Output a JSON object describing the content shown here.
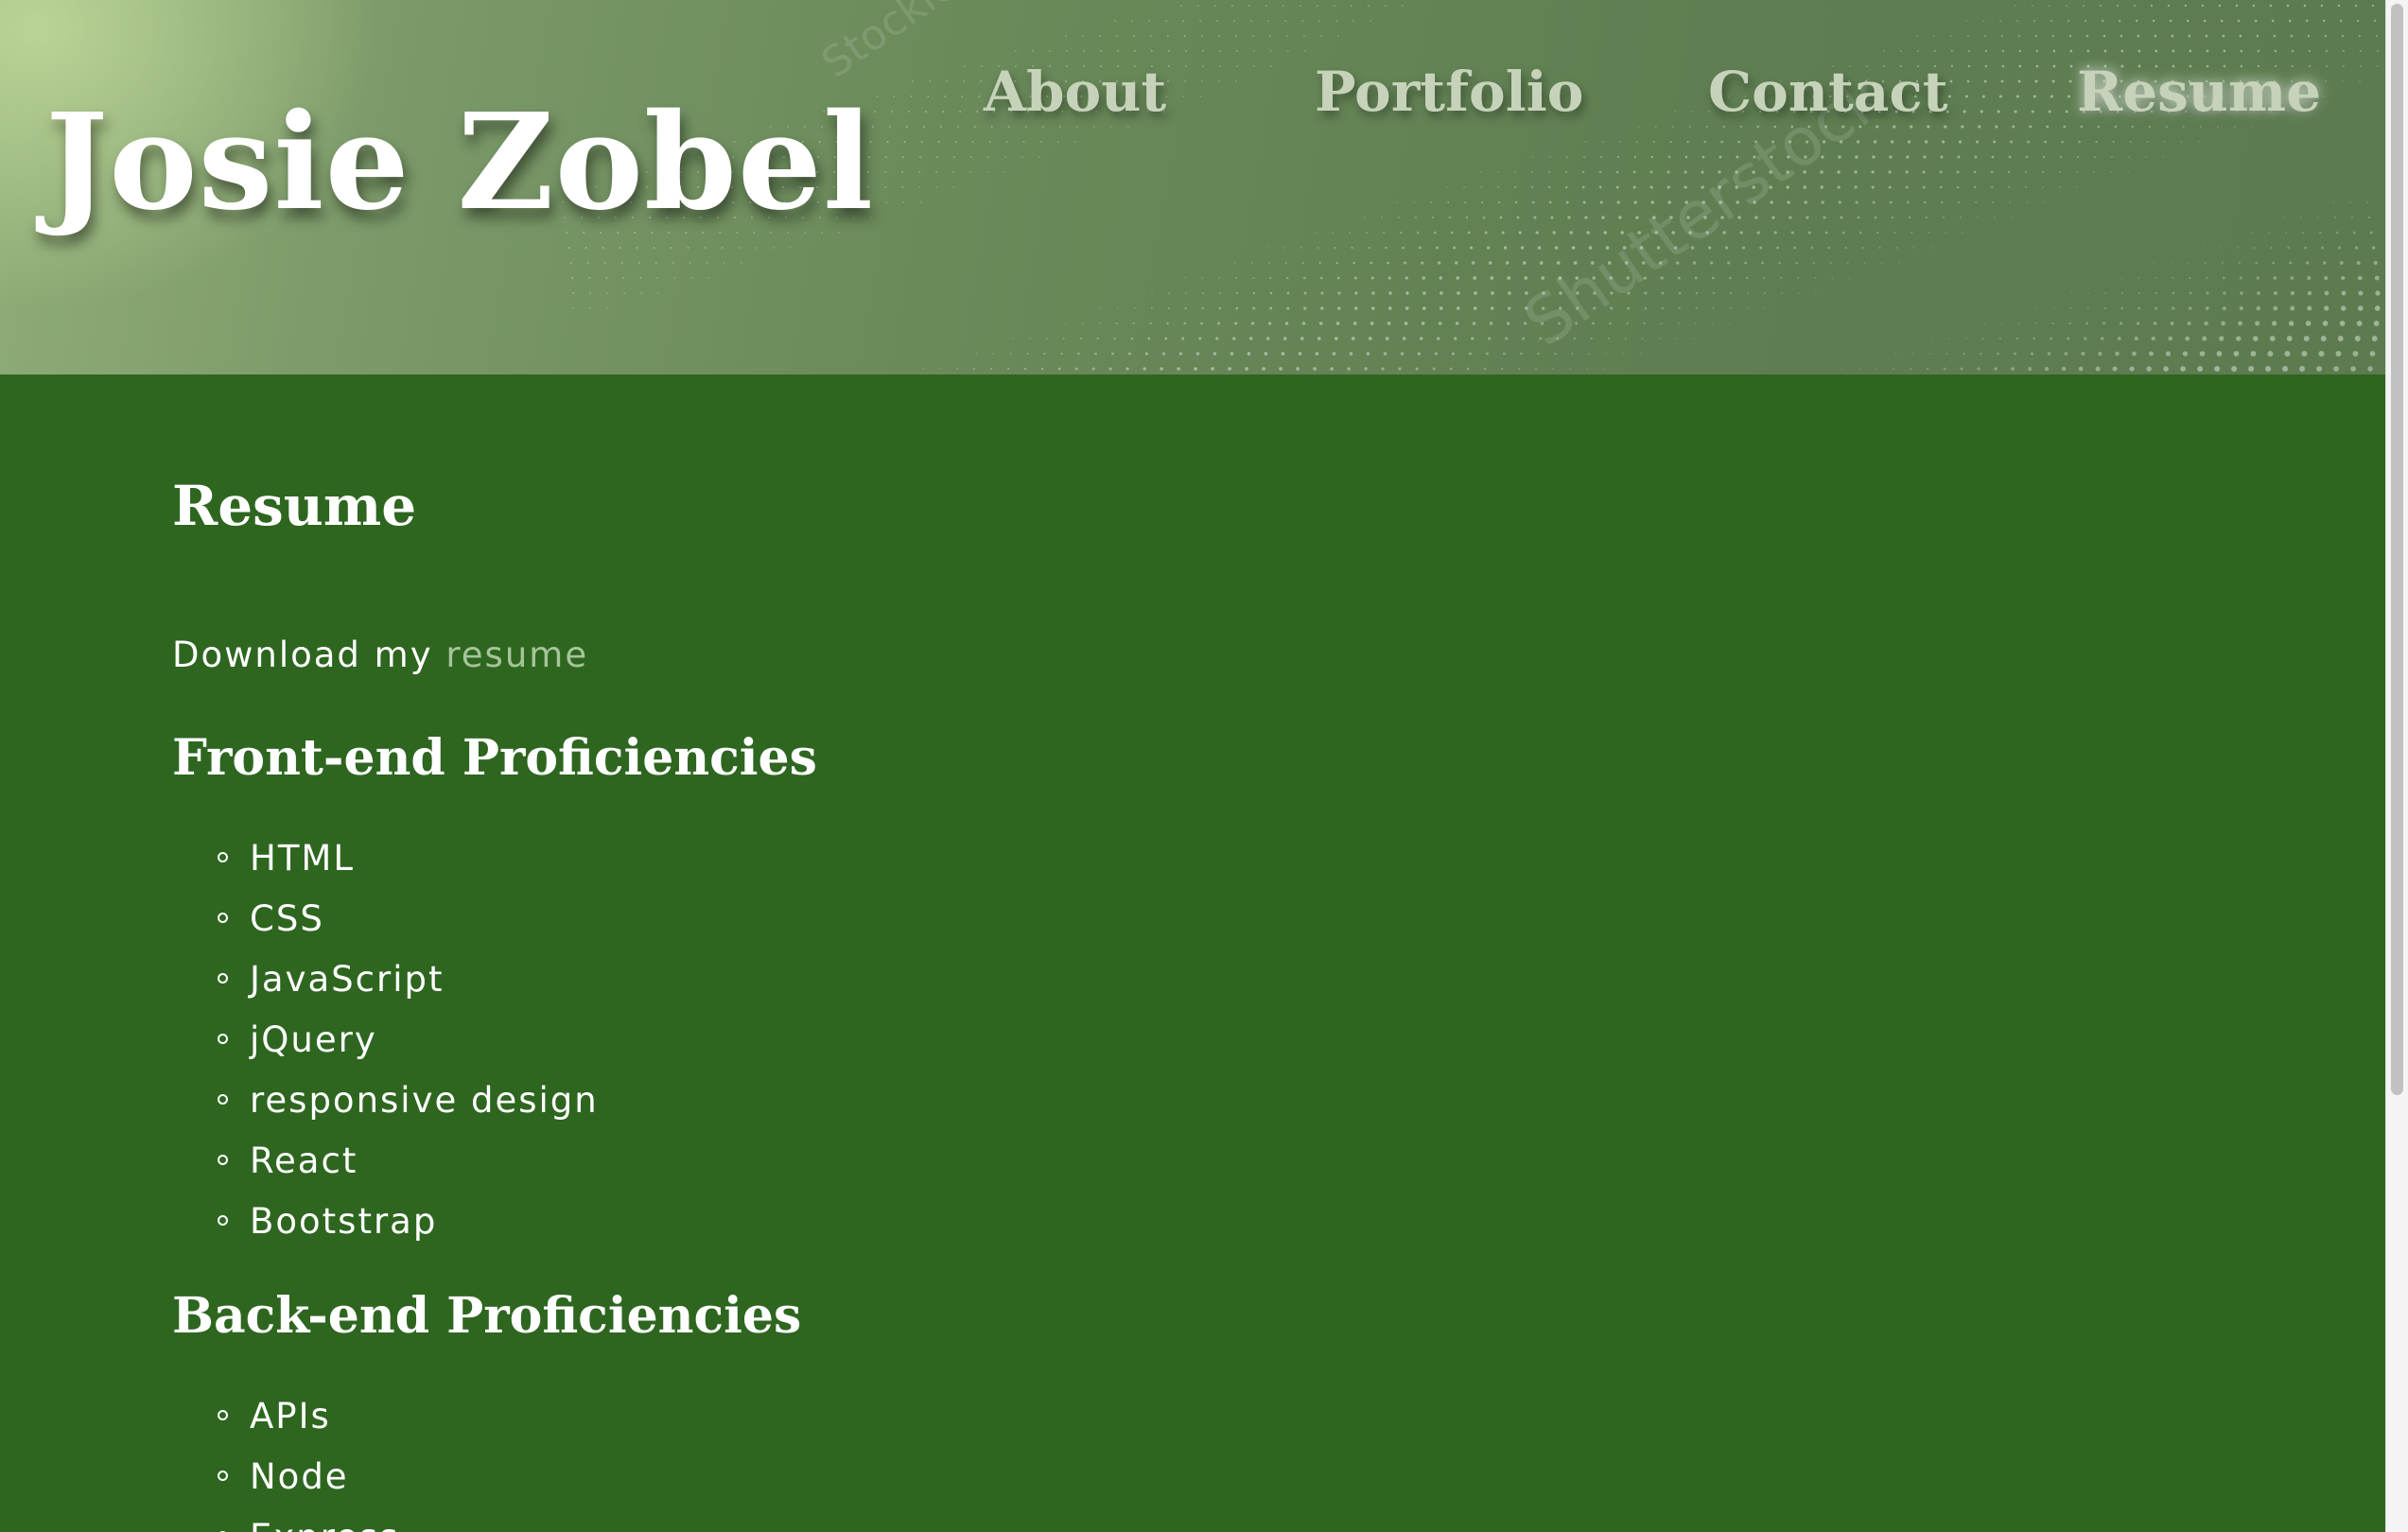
{
  "header": {
    "brand": "Josie Zobel",
    "nav": [
      {
        "label": "About"
      },
      {
        "label": "Portfolio"
      },
      {
        "label": "Contact"
      },
      {
        "label": "Resume",
        "active": true
      }
    ],
    "watermark_text": [
      "Stockle",
      "Shutterstock"
    ]
  },
  "main": {
    "title": "Resume",
    "download_prefix": "Download my",
    "download_link": "resume",
    "frontend": {
      "heading": "Front-end Proficiencies",
      "items": [
        "HTML",
        "CSS",
        "JavaScript",
        "jQuery",
        "responsive design",
        "React",
        "Bootstrap"
      ]
    },
    "backend": {
      "heading": "Back-end Proficiencies",
      "items": [
        "APIs",
        "Node",
        "Express"
      ]
    }
  },
  "colors": {
    "page_background": "#2e6620",
    "header_tint": "#5f7f52",
    "nav_text": "#c6d3ba",
    "link": "#a8c49a",
    "text": "#ffffff"
  },
  "icons": {
    "bullet": "hollow-circle-icon"
  }
}
